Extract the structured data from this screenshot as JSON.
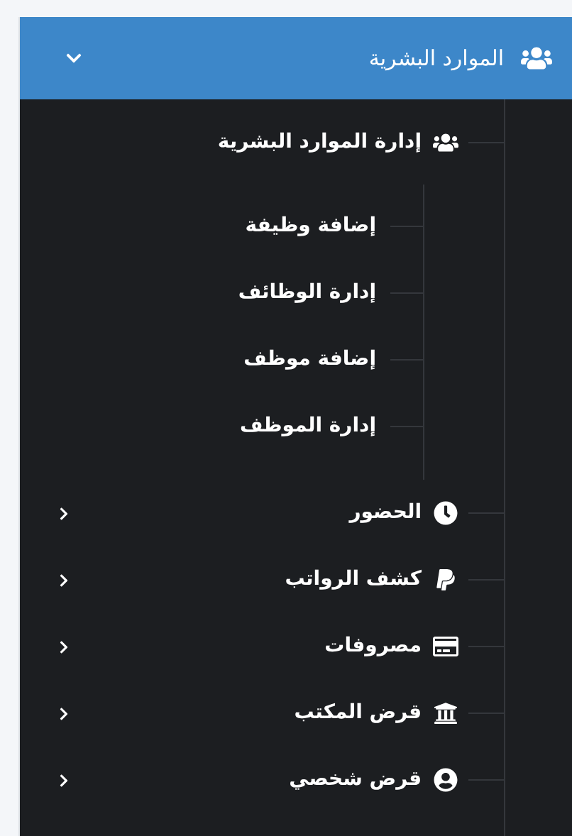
{
  "header": {
    "title": "الموارد البشرية",
    "expanded": true
  },
  "items": [
    {
      "label": "إدارة الموارد البشرية",
      "kind": "group",
      "children": [
        {
          "label": "إضافة وظيفة"
        },
        {
          "label": "إدارة الوظائف"
        },
        {
          "label": "إضافة موظف"
        },
        {
          "label": "إدارة الموظف"
        }
      ]
    },
    {
      "label": "الحضور",
      "kind": "link",
      "expanded": false
    },
    {
      "label": "كشف الرواتب",
      "kind": "link",
      "expanded": false
    },
    {
      "label": "مصروفات",
      "kind": "link",
      "expanded": false
    },
    {
      "label": "قرض المكتب",
      "kind": "link",
      "expanded": false
    },
    {
      "label": "قرض شخصي",
      "kind": "link",
      "expanded": false
    }
  ]
}
